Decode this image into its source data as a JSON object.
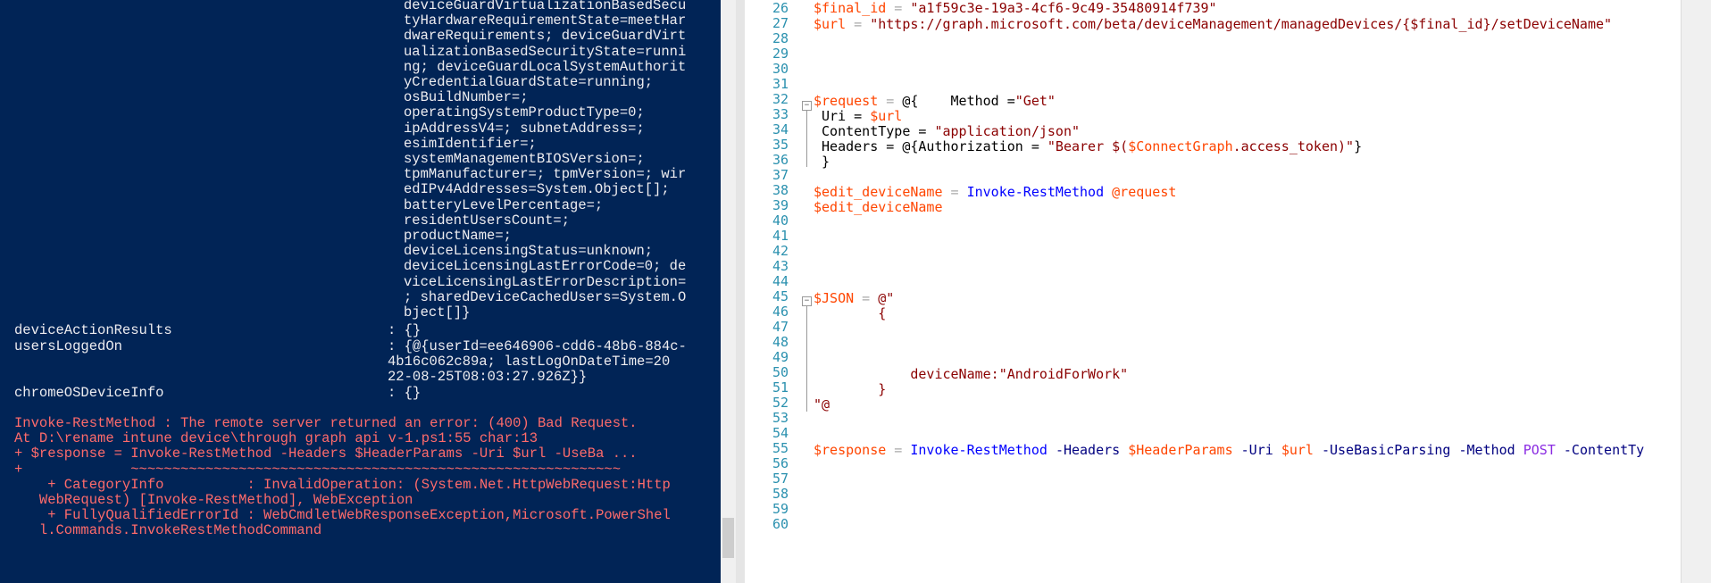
{
  "console": {
    "output_lines": [
      "deviceGuardVirtualizationBasedSecu",
      "tyHardwareRequirementState=meetHar",
      "dwareRequirements; deviceGuardVirt",
      "ualizationBasedSecurityState=runni",
      "ng; deviceGuardLocalSystemAuthorit",
      "yCredentialGuardState=running;",
      "osBuildNumber=;",
      "operatingSystemProductType=0;",
      "ipAddressV4=; subnetAddress=;",
      "esimIdentifier=;",
      "systemManagementBIOSVersion=;",
      "tpmManufacturer=; tpmVersion=; wir",
      "edIPv4Addresses=System.Object[];",
      "batteryLevelPercentage=;",
      "residentUsersCount=;",
      "productName=;",
      "deviceLicensingStatus=unknown;",
      "deviceLicensingLastErrorCode=0; de",
      "viceLicensingLastErrorDescription=",
      "; sharedDeviceCachedUsers=System.O",
      "bject[]}"
    ],
    "properties": [
      {
        "name": "deviceActionResults",
        "value": ": {}"
      },
      {
        "name": "usersLoggedOn",
        "value": ": {@{userId=ee646906-cdd6-48b6-884c-"
      },
      {
        "name": "",
        "value": "4b16c062c89a; lastLogOnDateTime=20"
      },
      {
        "name": "",
        "value": "22-08-25T08:03:27.926Z}}"
      },
      {
        "name": "chromeOSDeviceInfo",
        "value": ": {}"
      }
    ],
    "error_lines": [
      "Invoke-RestMethod : The remote server returned an error: (400) Bad Request.",
      "At D:\\rename intune device\\through graph api v-1.ps1:55 char:13",
      "+ $response = Invoke-RestMethod -Headers $HeaderParams -Uri $url -UseBa ...",
      "+             ~~~~~~~~~~~~~~~~~~~~~~~~~~~~~~~~~~~~~~~~~~~~~~~~~~~~~~~~~~~",
      "    + CategoryInfo          : InvalidOperation: (System.Net.HttpWebRequest:Http",
      "   WebRequest) [Invoke-RestMethod], WebException",
      "    + FullyQualifiedErrorId : WebCmdletWebResponseException,Microsoft.PowerShel",
      "   l.Commands.InvokeRestMethodCommand"
    ]
  },
  "editor": {
    "line_numbers": [
      "26",
      "27",
      "28",
      "29",
      "30",
      "31",
      "32",
      "33",
      "34",
      "35",
      "36",
      "37",
      "38",
      "39",
      "40",
      "41",
      "42",
      "43",
      "44",
      "45",
      "46",
      "47",
      "48",
      "49",
      "50",
      "51",
      "52",
      "53",
      "54",
      "55",
      "56",
      "57",
      "58",
      "59",
      "60"
    ],
    "tokens": {
      "final_id_var": "$final_id",
      "eq": " = ",
      "final_id_val": "\"a1f59c3e-19a3-4cf6-9c49-35480914f739\"",
      "url_var": "$url",
      "url_val": "\"https://graph.microsoft.com/beta/deviceManagement/managedDevices/{$final_id}/setDeviceName\"",
      "request_var": "$request",
      "hash_open": "@{",
      "method_key": "    Method =",
      "method_val": "\"Get\"",
      "uri_key": " Uri = ",
      "ctype_key": " ContentType = ",
      "ctype_val": "\"application/json\"",
      "headers_key": " Headers = @{Authorization = ",
      "bearer_a": "\"Bearer $(",
      "connect_var": "$ConnectGraph",
      "bearer_b": ".access_token)\"",
      "close_brace": "}",
      "close_hash": " }",
      "edit_var": "$edit_deviceName",
      "invoke_cmd": "Invoke-RestMethod",
      "splat_req": "@request",
      "json_var": "$JSON",
      "herestr_open": "@\"",
      "json_open": "        {",
      "json_body": "            deviceName:\"AndroidForWork\"",
      "json_close": "        }",
      "herestr_close": "\"@",
      "response_var": "$response",
      "headers_param": "-Headers",
      "header_params_var": "$HeaderParams",
      "uri_param": "-Uri",
      "basic_param": "-UseBasicParsing",
      "method_param": "-Method",
      "post_val": "POST",
      "ctype_param": "-ContentTy"
    }
  },
  "colors": {
    "console_bg": "#012456",
    "console_text": "#eeedf0",
    "error_text": "#ff6b6b",
    "line_number": "#2b91af",
    "variable": "#ff4500",
    "string": "#8b0000",
    "command": "#0000ff"
  }
}
